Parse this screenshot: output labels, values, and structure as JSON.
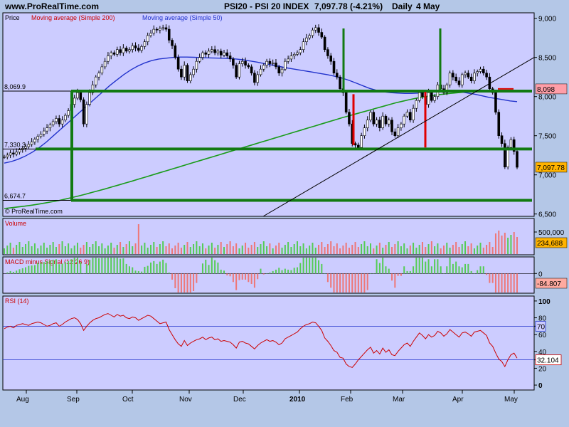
{
  "header": {
    "site": "www.ProRealTime.com",
    "instrument": "PSI20 - PSI 20 INDEX",
    "last_change": "7,097.78 (-4.21%)",
    "period": "Daily",
    "date": "4 May"
  },
  "chart_data": {
    "type": "candlestick",
    "price_panel": {
      "legend": [
        "Price",
        "Moving average (Simple 200)",
        "Moving average (Simple 50)"
      ],
      "y_ticks": [
        6500,
        7000,
        7500,
        8000,
        8500,
        9000
      ],
      "y_tick_labels": [
        "6,500",
        "7,000",
        "7,500",
        "8,000",
        "8,500",
        "9,000"
      ],
      "ylim": [
        6470,
        9070
      ],
      "level_labels": [
        "8,069.9",
        "7,330.3",
        "6,674.7"
      ],
      "level_values": [
        8069.9,
        7330.3,
        6674.7
      ],
      "right_tags": [
        {
          "text": "8,098",
          "value": 8098,
          "color": "#ff9ea8"
        },
        {
          "text": "7,097.78",
          "value": 7097.78,
          "color": "#ffb300"
        }
      ],
      "series_close": [
        7230,
        7252,
        7280,
        7265,
        7290,
        7320,
        7340,
        7360,
        7390,
        7420,
        7455,
        7490,
        7520,
        7560,
        7600,
        7640,
        7680,
        7720,
        7650,
        7700,
        7760,
        7820,
        7900,
        7980,
        8050,
        7960,
        7650,
        7900,
        8050,
        8150,
        8250,
        8300,
        8380,
        8450,
        8520,
        8560,
        8540,
        8600,
        8560,
        8620,
        8580,
        8600,
        8650,
        8620,
        8590,
        8640,
        8700,
        8780,
        8810,
        8860,
        8850,
        8870,
        8880,
        8860,
        8720,
        8650,
        8500,
        8350,
        8250,
        8400,
        8200,
        8280,
        8350,
        8450,
        8500,
        8560,
        8540,
        8580,
        8600,
        8560,
        8580,
        8530,
        8560,
        8520,
        8480,
        8400,
        8250,
        8420,
        8450,
        8400,
        8380,
        8300,
        8180,
        8280,
        8350,
        8400,
        8450,
        8420,
        8430,
        8380,
        8300,
        8350,
        8450,
        8480,
        8520,
        8540,
        8560,
        8600,
        8700,
        8750,
        8780,
        8850,
        8880,
        8820,
        8760,
        8600,
        8520,
        8450,
        8300,
        8250,
        8100,
        8050,
        7800,
        7650,
        7400,
        7380,
        7350,
        7500,
        7600,
        7700,
        7800,
        7650,
        7700,
        7600,
        7750,
        7650,
        7700,
        7550,
        7500,
        7600,
        7650,
        7750,
        7800,
        7700,
        7850,
        7950,
        8050,
        8000,
        7900,
        8050,
        7950,
        8000,
        8150,
        8100,
        8050,
        8150,
        8300,
        8250,
        8200,
        8150,
        8280,
        8300,
        8250,
        8200,
        8300,
        8320,
        8350,
        8300,
        8250,
        8100,
        8050,
        7800,
        7500,
        7400,
        7100,
        7350,
        7450,
        7300,
        7097
      ],
      "moving_average_200": [
        6570,
        6580,
        6590,
        6600,
        6612,
        6625,
        6640,
        6655,
        6670,
        6690,
        6710,
        6730,
        6752,
        6775,
        6798,
        6822,
        6847,
        6872,
        6897,
        6922,
        6948,
        6974,
        7000,
        7026,
        7052,
        7078,
        7104,
        7130,
        7156,
        7182,
        7208,
        7234,
        7260,
        7286,
        7312,
        7338,
        7364,
        7390,
        7416,
        7442,
        7468,
        7494,
        7520,
        7546,
        7572,
        7598,
        7624,
        7650,
        7676,
        7702,
        7728,
        7752,
        7776,
        7800,
        7824,
        7848,
        7872,
        7896,
        7920,
        7940,
        7960,
        7978,
        7994,
        8008,
        8020,
        8030,
        8040,
        8048,
        8055,
        8062,
        8066,
        8070,
        8072,
        8074,
        8076,
        8078,
        8080
      ],
      "moving_average_50": [
        7150,
        7170,
        7200,
        7240,
        7290,
        7350,
        7420,
        7500,
        7580,
        7660,
        7740,
        7820,
        7900,
        7980,
        8060,
        8140,
        8210,
        8280,
        8340,
        8390,
        8430,
        8460,
        8480,
        8490,
        8500,
        8505,
        8505,
        8502,
        8498,
        8495,
        8492,
        8490,
        8486,
        8480,
        8470,
        8455,
        8440,
        8422,
        8405,
        8388,
        8370,
        8355,
        8340,
        8325,
        8310,
        8295,
        8280,
        8260,
        8238,
        8210,
        8175,
        8140,
        8105,
        8080,
        8060,
        8050,
        8045,
        8040,
        8040,
        8045,
        8055,
        8065,
        8072,
        8075,
        8070,
        8060,
        8045,
        8030,
        8010,
        7990,
        7975,
        7960,
        7945,
        7935
      ]
    },
    "volume_panel": {
      "label": "Volume",
      "y_tick_labels": [
        "500,000"
      ],
      "right_tag": "234,688"
    },
    "macd_panel": {
      "label": "MACD minus Signal (12 26 9)",
      "y_tick_labels": [
        "0"
      ],
      "right_tag": "-84.807",
      "ylim": [
        -180,
        150
      ]
    },
    "rsi_panel": {
      "label": "RSI (14)",
      "y_ticks": [
        0,
        20,
        30,
        40,
        60,
        70,
        80,
        100
      ],
      "ylim": [
        -5,
        105
      ],
      "overbought": 70,
      "oversold": 30,
      "right_tag": "32.104",
      "series": [
        67,
        69,
        70,
        68,
        71,
        72,
        73,
        72,
        71,
        73,
        74,
        75,
        74,
        72,
        70,
        71,
        73,
        74,
        70,
        72,
        75,
        77,
        79,
        80,
        78,
        73,
        65,
        70,
        74,
        77,
        79,
        80,
        82,
        84,
        85,
        83,
        81,
        84,
        82,
        83,
        80,
        79,
        81,
        80,
        77,
        79,
        81,
        83,
        82,
        79,
        76,
        73,
        74,
        75,
        66,
        60,
        54,
        49,
        46,
        53,
        47,
        50,
        52,
        54,
        55,
        57,
        54,
        56,
        57,
        54,
        55,
        52,
        53,
        52,
        51,
        48,
        44,
        51,
        52,
        50,
        49,
        46,
        43,
        47,
        50,
        52,
        54,
        52,
        53,
        51,
        48,
        50,
        55,
        57,
        59,
        61,
        63,
        67,
        70,
        72,
        73,
        75,
        74,
        70,
        65,
        56,
        52,
        47,
        41,
        39,
        33,
        32,
        25,
        22,
        21,
        25,
        30,
        34,
        38,
        42,
        45,
        38,
        41,
        37,
        44,
        39,
        42,
        36,
        35,
        40,
        44,
        48,
        50,
        46,
        52,
        57,
        62,
        59,
        55,
        60,
        57,
        59,
        64,
        62,
        58,
        61,
        66,
        63,
        60,
        57,
        62,
        63,
        61,
        58,
        63,
        64,
        65,
        62,
        59,
        50,
        46,
        38,
        31,
        28,
        22,
        30,
        36,
        38,
        32
      ]
    },
    "x_tick_labels": [
      "Aug",
      "Sep",
      "Oct",
      "Nov",
      "Dec",
      "2010",
      "Feb",
      "Mar",
      "Apr",
      "May"
    ],
    "watermark": "© ProRealTime.com",
    "colors": {
      "panel_bg": "#ccccff",
      "frame_bg": "#b4c7e7",
      "up": "#ffffff",
      "down": "#000000",
      "ma200": "#1a9c1a",
      "ma50": "#2233cc",
      "drawn_lines": "#127a12",
      "markers": "#e00000",
      "volume_up": "#55cc55",
      "volume_down": "#ee7777",
      "rsi_line": "#cc0000"
    }
  }
}
